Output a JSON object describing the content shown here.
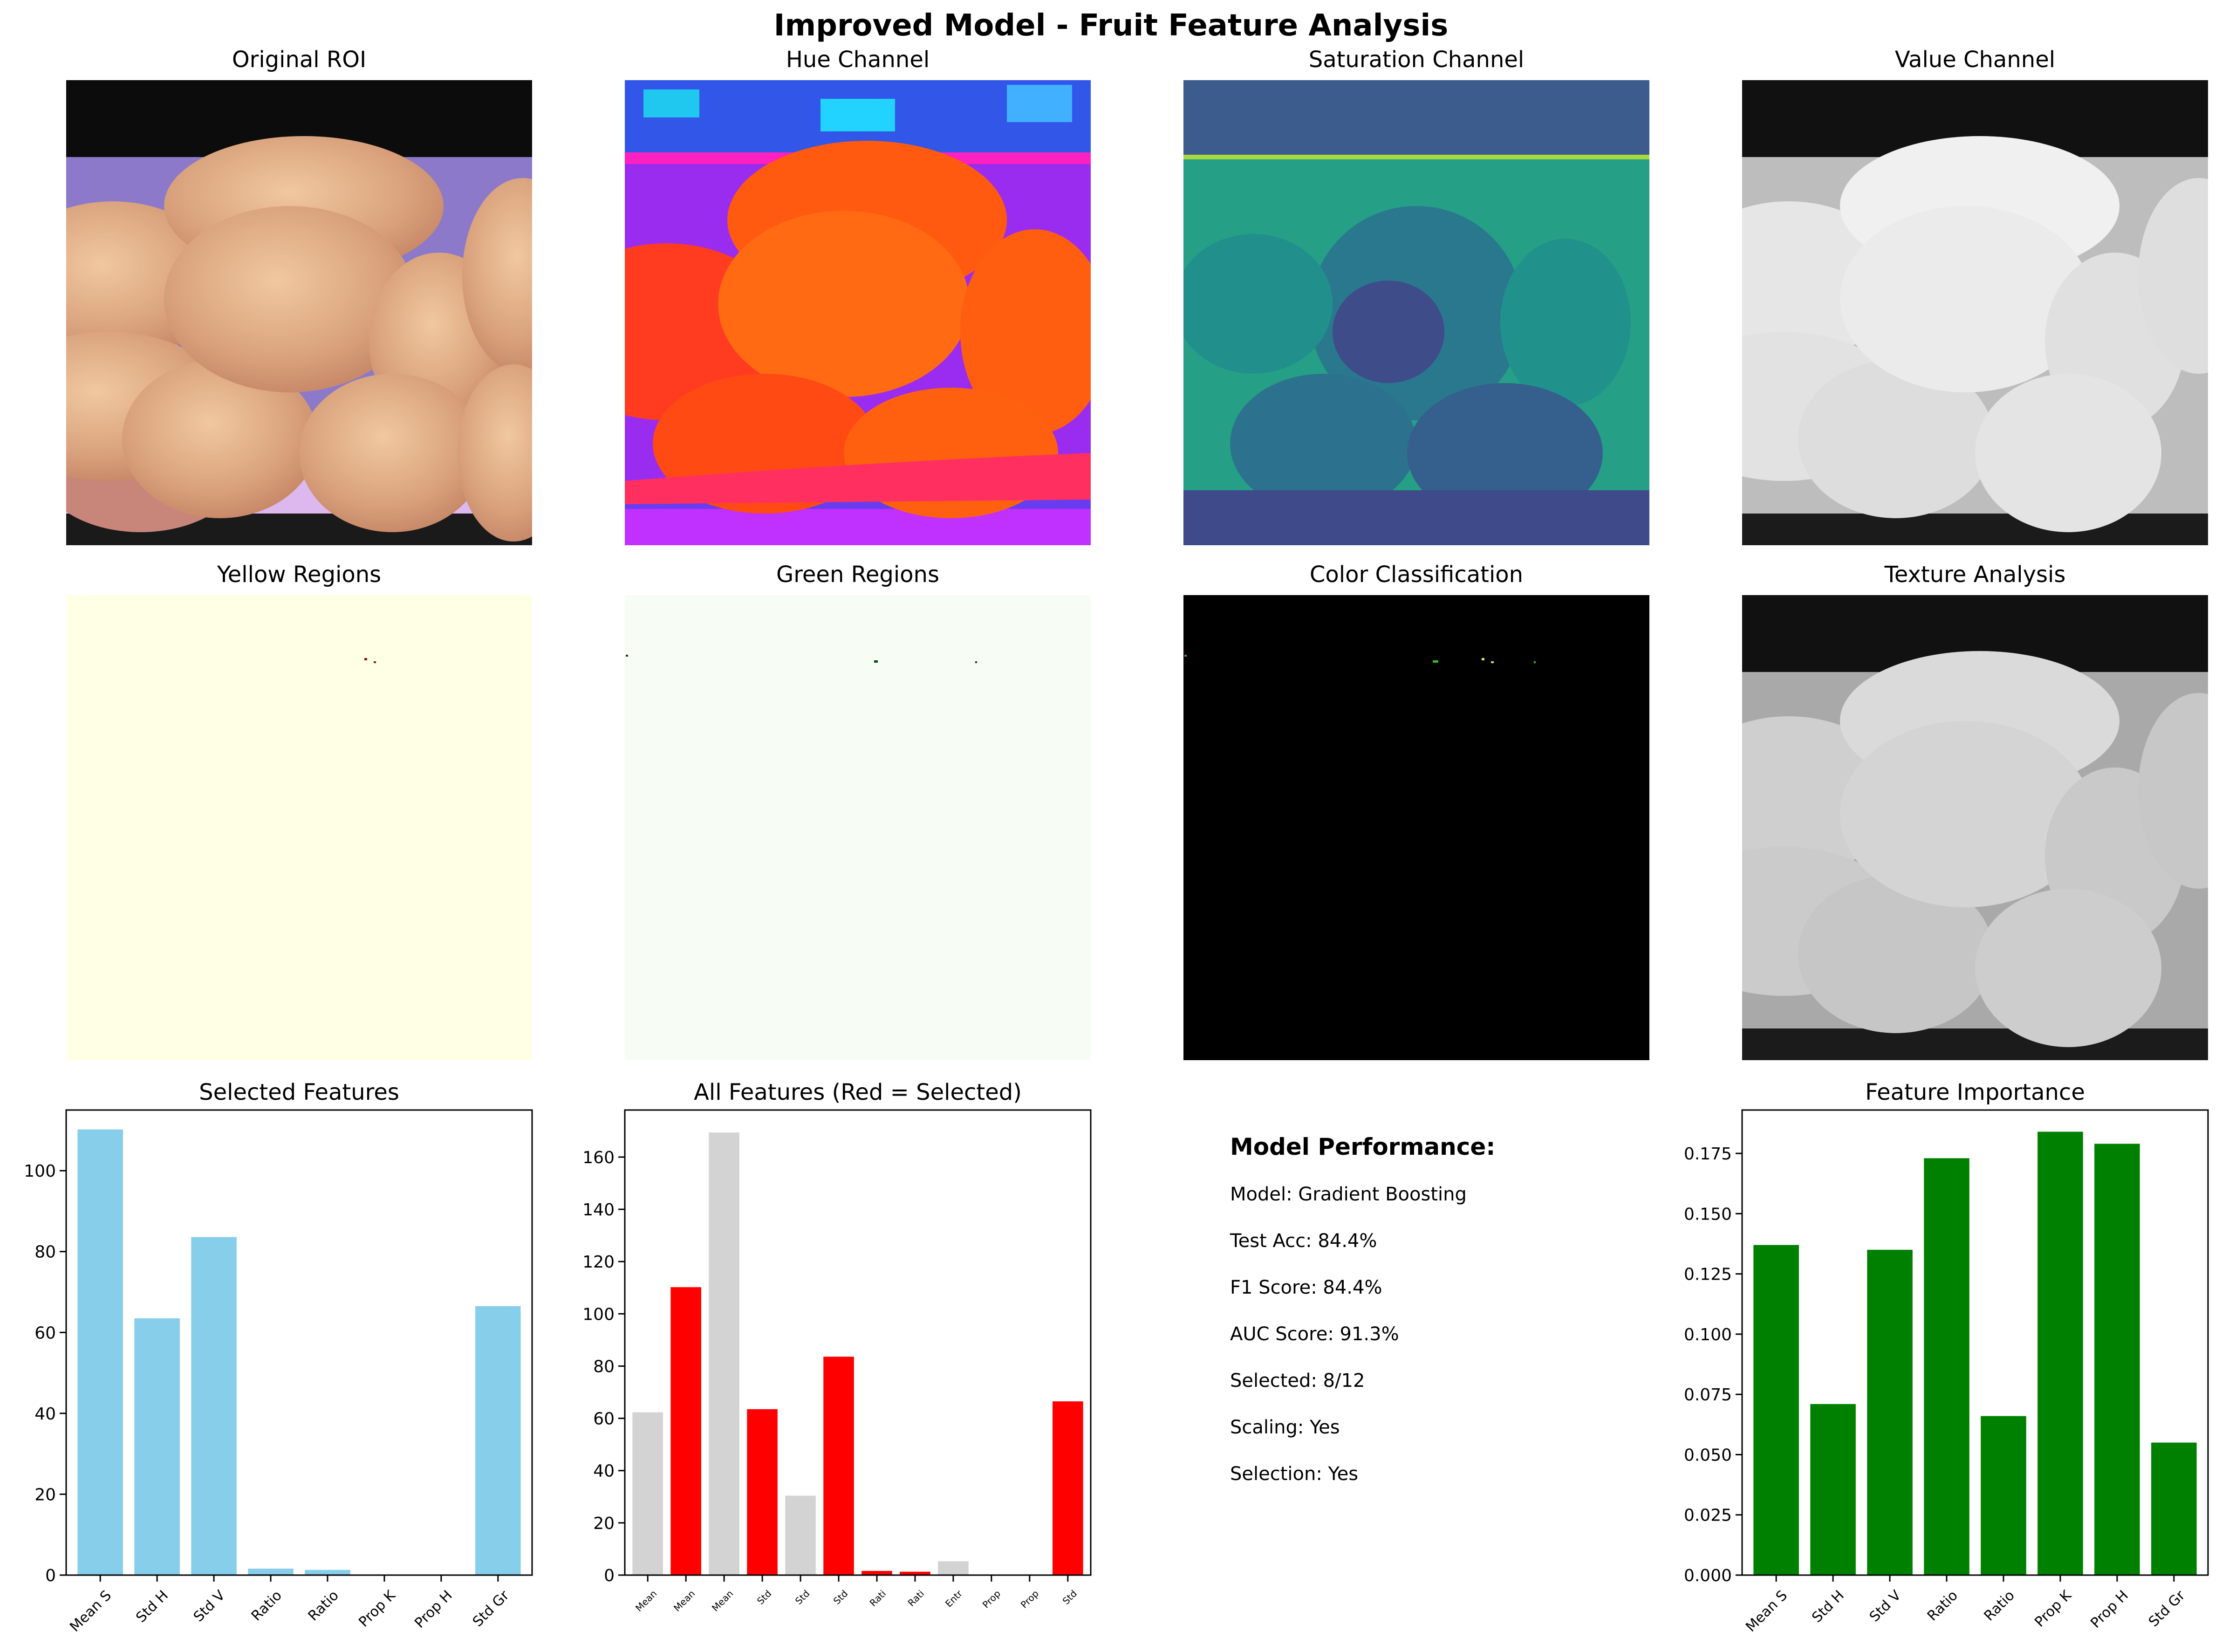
{
  "figure": {
    "title": "Improved Model - Fruit Feature Analysis"
  },
  "panels": {
    "original_roi": "Original ROI",
    "hue": "Hue Channel",
    "saturation": "Saturation Channel",
    "value": "Value Channel",
    "yellow": "Yellow Regions",
    "green": "Green Regions",
    "color_class": "Color Classification",
    "texture": "Texture Analysis"
  },
  "colors": {
    "selected_bar": "#87ceeb",
    "unselected_bar": "#d3d3d3",
    "highlight_bar": "#ff0000",
    "importance_bar": "#008000",
    "yellow_mask": "#ffffe5",
    "green_mask": "#f7fcf5"
  },
  "performance": {
    "heading": "Model Performance:",
    "lines": [
      "Model: Gradient Boosting",
      "Test Acc: 84.4%",
      "F1 Score: 84.4%",
      "AUC Score: 91.3%",
      "Selected: 8/12",
      "Scaling: Yes",
      "Selection: Yes"
    ]
  },
  "chart_data": [
    {
      "type": "bar",
      "title": "Selected Features",
      "categories": [
        "Mean S",
        "Std H",
        "Std V",
        "Ratio",
        "Ratio",
        "Prop K",
        "Prop H",
        "Std Gr"
      ],
      "values": [
        110.2,
        63.5,
        83.6,
        1.6,
        1.3,
        0.1,
        0.1,
        66.5
      ],
      "ylim": [
        0,
        115
      ],
      "yticks": [
        0,
        20,
        40,
        60,
        80,
        100
      ],
      "color": "#87ceeb"
    },
    {
      "type": "bar",
      "title": "All Features (Red = Selected)",
      "categories": [
        "Mean",
        "Mean",
        "Mean",
        "Std",
        "Std",
        "Std",
        "Rati",
        "Rati",
        "Entr",
        "Prop",
        "Prop",
        "Std"
      ],
      "values": [
        62.3,
        110.2,
        169.4,
        63.5,
        30.4,
        83.6,
        1.6,
        1.3,
        5.3,
        0.1,
        0.1,
        66.5
      ],
      "selected": [
        false,
        true,
        false,
        true,
        false,
        true,
        true,
        true,
        false,
        true,
        true,
        true
      ],
      "ylim": [
        0,
        178
      ],
      "yticks": [
        0,
        20,
        40,
        60,
        80,
        100,
        120,
        140,
        160
      ]
    },
    {
      "type": "bar",
      "title": "Feature Importance",
      "categories": [
        "Mean S",
        "Std H",
        "Std V",
        "Ratio",
        "Ratio",
        "Prop K",
        "Prop H",
        "Std Gr"
      ],
      "values": [
        0.137,
        0.071,
        0.135,
        0.173,
        0.066,
        0.184,
        0.179,
        0.055
      ],
      "ylim": [
        0,
        0.193
      ],
      "yticks": [
        0.0,
        0.025,
        0.05,
        0.075,
        0.1,
        0.125,
        0.15,
        0.175
      ],
      "ytick_decimals": 3,
      "color": "#008000"
    }
  ]
}
